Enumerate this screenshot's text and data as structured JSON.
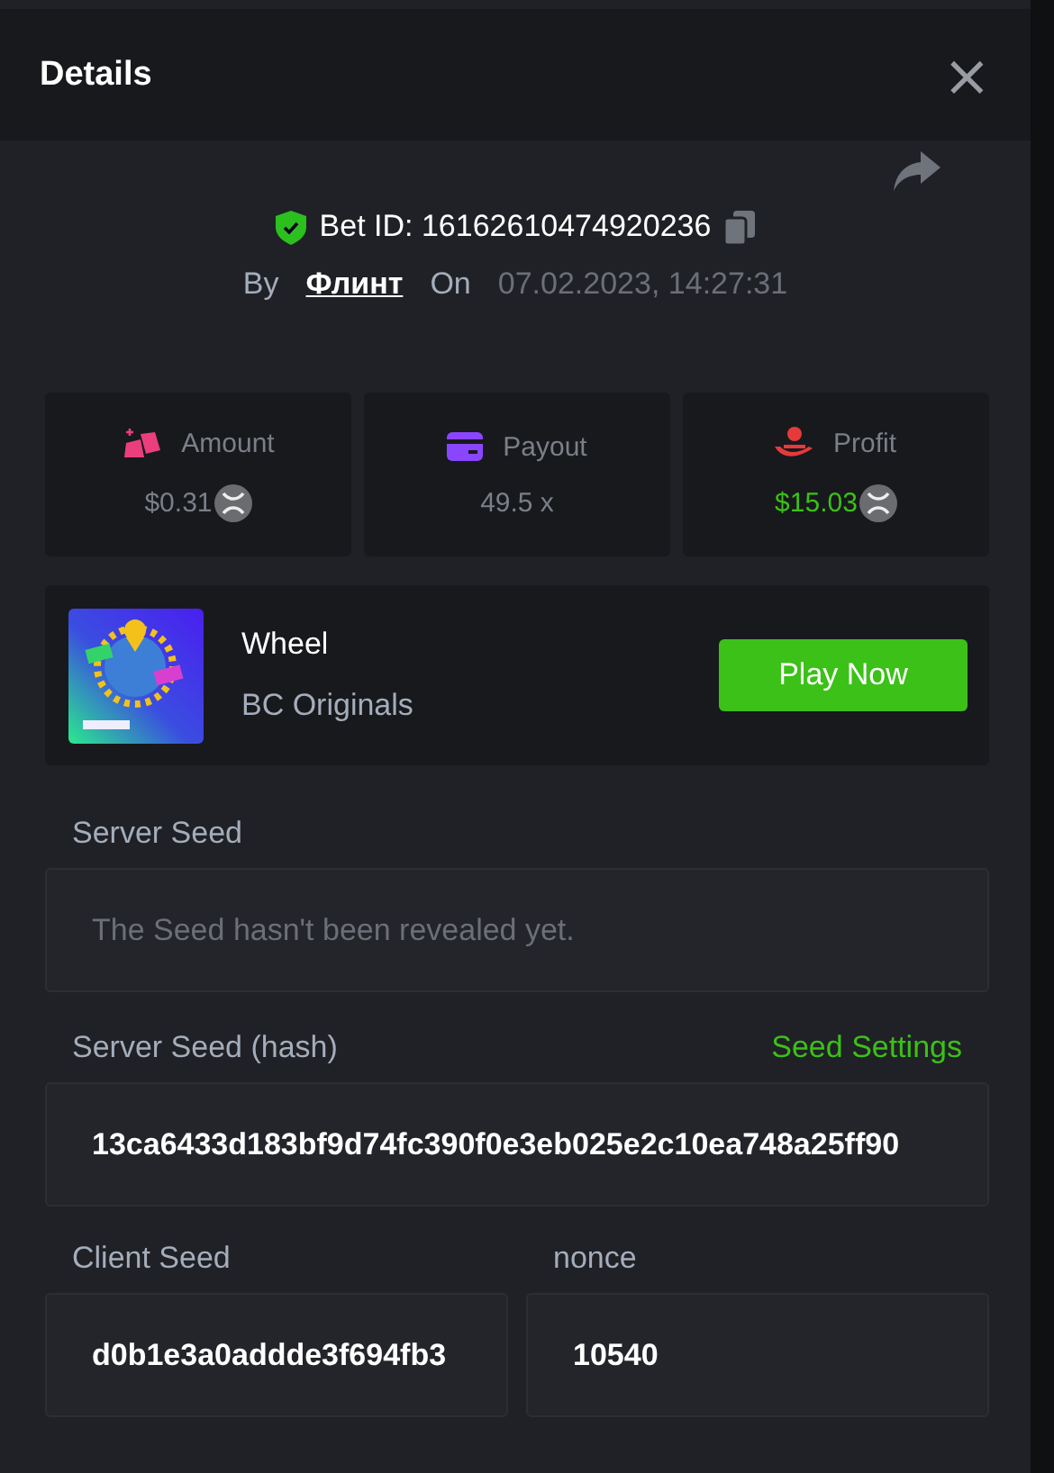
{
  "modal": {
    "title": "Details",
    "close": "×"
  },
  "bet": {
    "label": "Bet ID:",
    "id": "16162610474920236",
    "by_label": "By",
    "user": "Флинт",
    "on_label": "On",
    "date": "07.02.2023, 14:27:31",
    "verified": true
  },
  "stats": [
    {
      "kind": "amount",
      "label": "Amount",
      "value": "$0.31",
      "highlight": false,
      "currency": true
    },
    {
      "kind": "payout",
      "label": "Payout",
      "value": "49.5 x",
      "highlight": false,
      "currency": false
    },
    {
      "kind": "profit",
      "label": "Profit",
      "value": "$15.03",
      "highlight": true,
      "currency": true
    }
  ],
  "game": {
    "name": "Wheel",
    "provider": "BC Originals",
    "button": "Play Now"
  },
  "seeds": [
    {
      "label": "Server Seed",
      "placeholder": "The Seed hasn't been revealed yet."
    },
    {
      "label": "Server Seed (hash)",
      "value": "13ca6433d183bf9d74fc390f0e3eb025e2c10ea748a25ff90",
      "link": "Seed Settings"
    }
  ],
  "client_seed": {
    "label": "Client Seed",
    "value": "d0b1e3a0addde3f694fb3"
  },
  "nonce": {
    "label": "nonce",
    "value": "10540"
  }
}
